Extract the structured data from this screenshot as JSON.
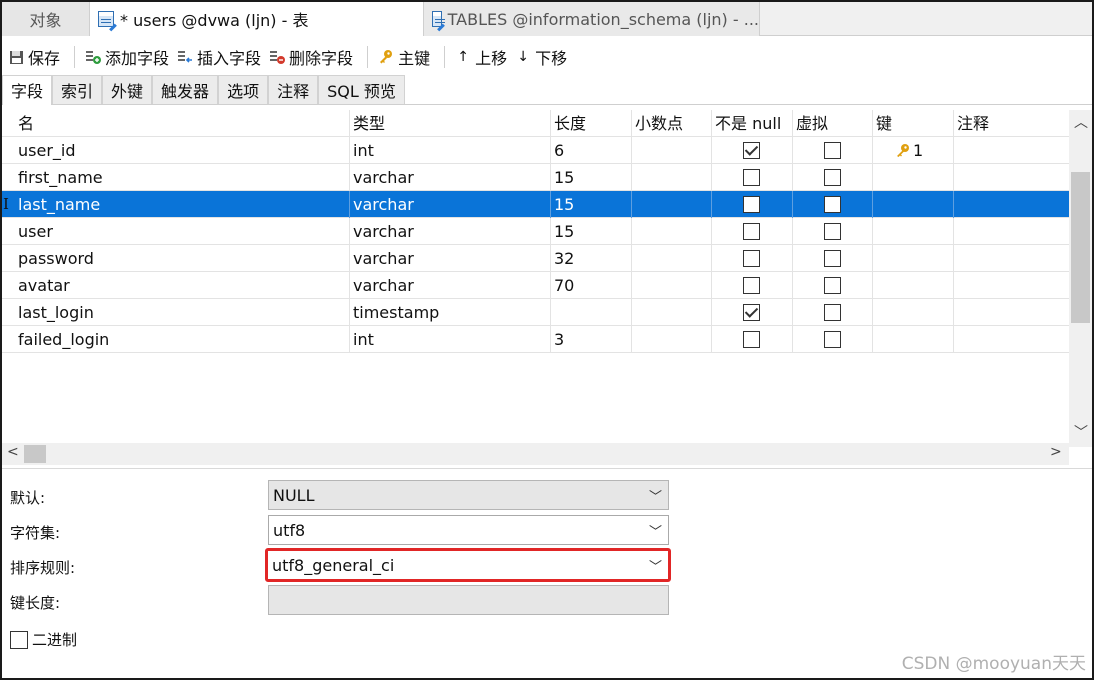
{
  "tabs": {
    "objects": "对象",
    "active": "* users @dvwa (ljn) - 表",
    "inactive": "TABLES @information_schema (ljn) - ..."
  },
  "toolbar": {
    "save": "保存",
    "add_field": "添加字段",
    "insert_field": "插入字段",
    "delete_field": "删除字段",
    "primary_key": "主键",
    "move_up": "上移",
    "move_down": "下移"
  },
  "subtabs": [
    "字段",
    "索引",
    "外键",
    "触发器",
    "选项",
    "注释",
    "SQL 预览"
  ],
  "grid": {
    "headers": [
      "名",
      "类型",
      "长度",
      "小数点",
      "不是 null",
      "虚拟",
      "键",
      "注释"
    ],
    "rows": [
      {
        "name": "user_id",
        "type": "int",
        "length": "6",
        "not_null": true,
        "virtual": false,
        "key": "1"
      },
      {
        "name": "first_name",
        "type": "varchar",
        "length": "15",
        "not_null": false,
        "virtual": false,
        "key": ""
      },
      {
        "name": "last_name",
        "type": "varchar",
        "length": "15",
        "not_null": false,
        "virtual": false,
        "key": "",
        "selected": true
      },
      {
        "name": "user",
        "type": "varchar",
        "length": "15",
        "not_null": false,
        "virtual": false,
        "key": ""
      },
      {
        "name": "password",
        "type": "varchar",
        "length": "32",
        "not_null": false,
        "virtual": false,
        "key": ""
      },
      {
        "name": "avatar",
        "type": "varchar",
        "length": "70",
        "not_null": false,
        "virtual": false,
        "key": ""
      },
      {
        "name": "last_login",
        "type": "timestamp",
        "length": "",
        "not_null": true,
        "virtual": false,
        "key": ""
      },
      {
        "name": "failed_login",
        "type": "int",
        "length": "3",
        "not_null": false,
        "virtual": false,
        "key": ""
      }
    ]
  },
  "props": {
    "default_label": "默认:",
    "default_value": "NULL",
    "charset_label": "字符集:",
    "charset_value": "utf8",
    "collation_label": "排序规则:",
    "collation_value": "utf8_general_ci",
    "keylen_label": "键长度:",
    "binary_label": "二进制"
  },
  "watermark": "CSDN @mooyuan天天",
  "colors": {
    "selection": "#0a74d8",
    "highlight_border": "#e12626",
    "key_icon": "#e0a010"
  }
}
